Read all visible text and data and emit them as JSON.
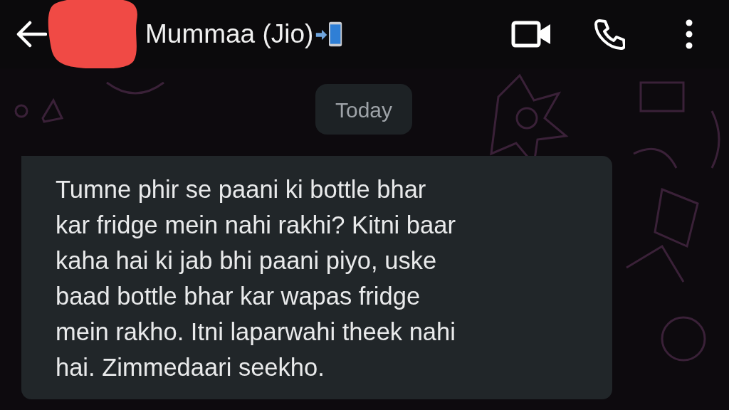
{
  "header": {
    "title": "Mummaa (Jio)"
  },
  "date_chip": "Today",
  "messages": [
    {
      "kind": "incoming",
      "text": "Tumne phir se paani ki bottle bhar\nkar fridge mein nahi rakhi? Kitni baar\nkaha hai ki jab bhi paani piyo, uske\nbaad bottle bhar kar wapas fridge\nmein rakho. Itni laparwahi theek nahi\nhai. Zimmedaari seekho."
    }
  ]
}
